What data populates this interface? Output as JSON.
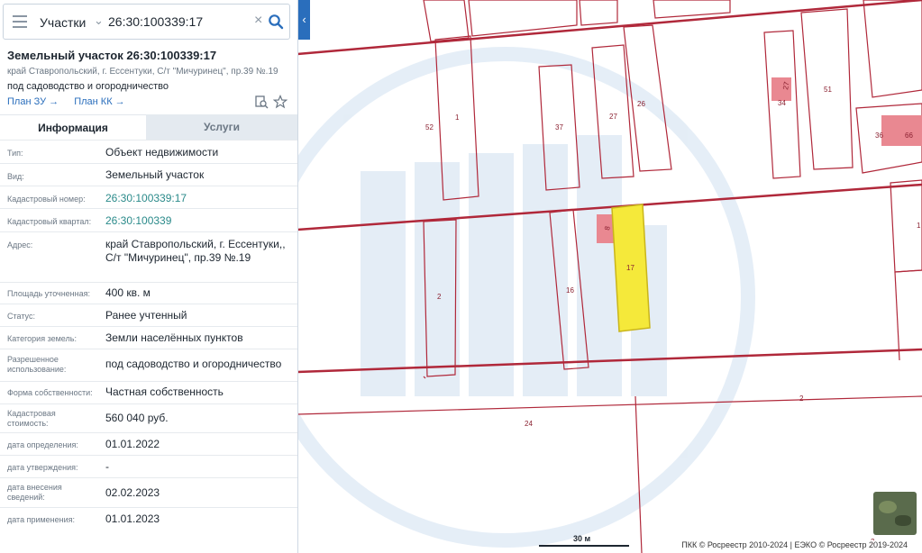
{
  "search": {
    "layer": "Участки",
    "query": "26:30:100339:17"
  },
  "card": {
    "title": "Земельный участок 26:30:100339:17",
    "address": "край Ставропольский, г. Ессентуки, С/т \"Мичуринец\", пр.39 №.19",
    "use": "под садоводство и огородничество",
    "link_plan_zu": "План ЗУ",
    "link_plan_kk": "План КК"
  },
  "tabs": {
    "info": "Информация",
    "services": "Услуги"
  },
  "props": [
    {
      "label": "Тип:",
      "value": "Объект недвижимости"
    },
    {
      "label": "Вид:",
      "value": "Земельный участок"
    },
    {
      "label": "Кадастровый номер:",
      "value": "26:30:100339:17"
    },
    {
      "label": "Кадастровый квартал:",
      "value": "26:30:100339"
    },
    {
      "label": "Адрес:",
      "value": "край Ставропольский, г. Ессентуки,, С/т \"Мичуринец\", пр.39 №.19"
    },
    {
      "label": "Площадь уточненная:",
      "value": "400 кв. м"
    },
    {
      "label": "Статус:",
      "value": "Ранее учтенный"
    },
    {
      "label": "Категория земель:",
      "value": "Земли населённых пунктов"
    },
    {
      "label": "Разрешенное использование:",
      "value": "под садоводство и огородничество"
    },
    {
      "label": "Форма собственности:",
      "value": "Частная собственность"
    },
    {
      "label": "Кадастровая стоимость:",
      "value": "560 040 руб."
    },
    {
      "label": "дата определения:",
      "value": "01.01.2022"
    },
    {
      "label": "дата утверждения:",
      "value": "-"
    },
    {
      "label": "дата внесения сведений:",
      "value": "02.02.2023"
    },
    {
      "label": "дата применения:",
      "value": "01.01.2023"
    }
  ],
  "map": {
    "parcel_labels": [
      "52",
      "1",
      "37",
      "27",
      "26",
      "34",
      "27",
      "51",
      "36",
      "66",
      "2",
      "16",
      "17",
      "8",
      "1",
      "2",
      "24",
      "2"
    ],
    "scale": "30 м",
    "copyright": "ПКК © Росреестр 2010-2024 | ЕЭКО © Росреестр 2019-2024",
    "colors": {
      "parcel_line": "#b0283a",
      "selected_fill": "#f5e93a",
      "building_fill": "#e98891",
      "watermark": "#d4e3f2"
    }
  }
}
